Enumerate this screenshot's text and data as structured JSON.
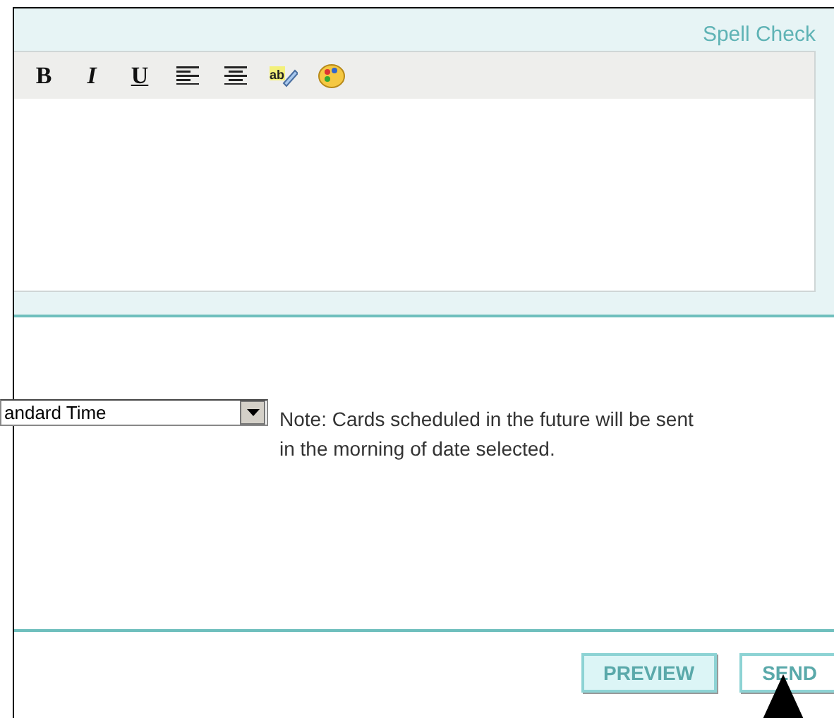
{
  "spell_check_link": "Spell Check",
  "toolbar": [
    {
      "kind": "bold",
      "label": "B"
    },
    {
      "kind": "italic",
      "label": "I"
    },
    {
      "kind": "underline",
      "label": "U"
    },
    {
      "kind": "align-left"
    },
    {
      "kind": "align-center"
    },
    {
      "kind": "spell",
      "icon_text": "ab"
    },
    {
      "kind": "palette"
    }
  ],
  "timezone_select": {
    "value": "andard Time"
  },
  "note": "Note: Cards scheduled in the future will be sent in the morning of date selected.",
  "buttons": [
    {
      "label": "PREVIEW",
      "kind": "filled"
    },
    {
      "label": "SEND",
      "kind": "outline"
    }
  ]
}
